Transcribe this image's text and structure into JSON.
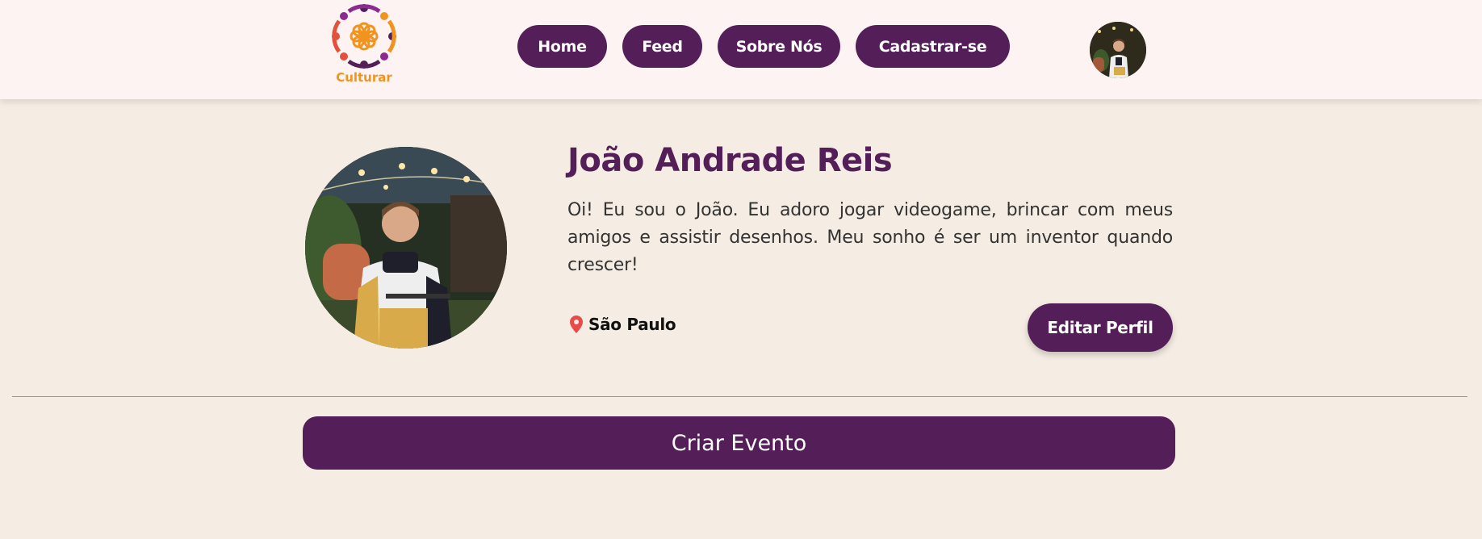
{
  "header": {
    "logo_text": "Culturar",
    "nav": [
      {
        "label": "Home"
      },
      {
        "label": "Feed"
      },
      {
        "label": "Sobre Nós"
      },
      {
        "label": "Cadastrar-se"
      }
    ]
  },
  "profile": {
    "name": "João Andrade Reis",
    "bio": "Oi! Eu sou o João. Eu adoro jogar videogame, brincar com meus amigos e assistir desenhos. Meu sonho é ser um inventor quando crescer!",
    "location": "São Paulo",
    "edit_label": "Editar Perfil"
  },
  "create_event_label": "Criar Evento",
  "colors": {
    "brand": "#541e58",
    "header_bg": "#fdf3f2",
    "page_bg": "#f5ede3",
    "logo_orange": "#f0941f",
    "pin_red": "#e94b4b"
  },
  "icons": [
    "culturar-logo",
    "location-pin-icon",
    "user-avatar-photo"
  ]
}
